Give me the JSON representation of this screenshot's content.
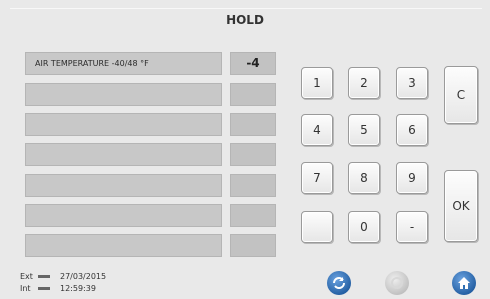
{
  "header": {
    "title": "HOLD"
  },
  "parameters": [
    {
      "label": "AIR TEMPERATURE -40/48 °F",
      "value": "-4"
    },
    {
      "label": "",
      "value": ""
    },
    {
      "label": "",
      "value": ""
    },
    {
      "label": "",
      "value": ""
    },
    {
      "label": "",
      "value": ""
    },
    {
      "label": "",
      "value": ""
    },
    {
      "label": "",
      "value": ""
    }
  ],
  "keypad": {
    "k1": "1",
    "k2": "2",
    "k3": "3",
    "k4": "4",
    "k5": "5",
    "k6": "6",
    "k7": "7",
    "k8": "8",
    "k9": "9",
    "blank": "",
    "k0": "0",
    "minus": "-",
    "clear": "C",
    "ok": "OK"
  },
  "status": {
    "ext_label": "Ext",
    "ext_date": "27/03/2015",
    "int_label": "Int",
    "int_time": "12:59:39"
  },
  "nav_icons": [
    "refresh-icon",
    "disabled-icon",
    "home-icon"
  ],
  "colors": {
    "background": "#e9e9e9",
    "field": "#c8c8c8",
    "blue": "#2f6fb3"
  }
}
